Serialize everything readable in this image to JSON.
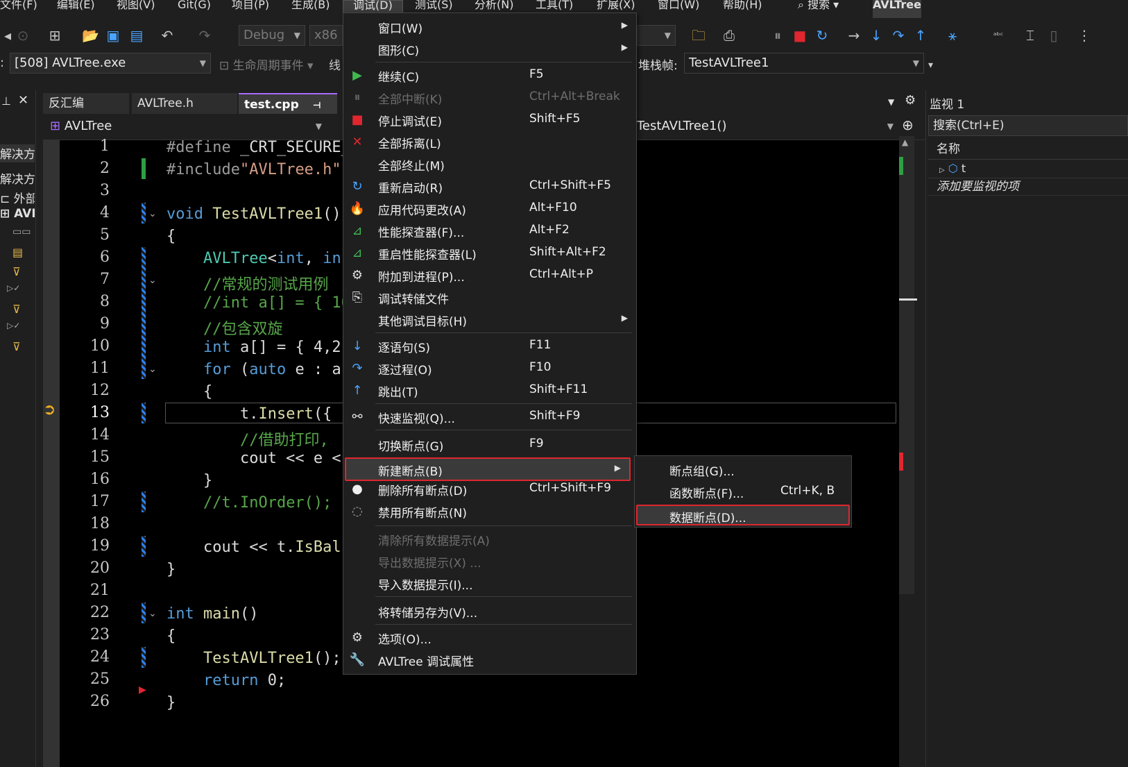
{
  "menubar": {
    "items": [
      "文件(F)",
      "编辑(E)",
      "视图(V)",
      "Git(G)",
      "项目(P)",
      "生成(B)",
      "调试(D)",
      "测试(S)",
      "分析(N)",
      "工具(T)",
      "扩展(X)",
      "窗口(W)",
      "帮助(H)"
    ],
    "search_label": "搜索",
    "app_title": "AVLTree"
  },
  "toolbar": {
    "config": "Debug",
    "platform": "x86",
    "process": "[508] AVLTree.exe",
    "lifecycle_label": "生命周期事件",
    "thread_label": "线",
    "stackframe_label": "堆栈帧:",
    "stackframe_value": "TestAVLTree1"
  },
  "left_panel": {
    "items": [
      "解决方",
      "解决方",
      "外部",
      "AVL"
    ]
  },
  "tabs": [
    {
      "label": "反汇编"
    },
    {
      "label": "AVLTree.h"
    },
    {
      "label": "test.cpp"
    }
  ],
  "nav": {
    "scope": "AVLTree",
    "function": "TestAVLTree1()"
  },
  "code": {
    "line_numbers": [
      "1",
      "2",
      "3",
      "4",
      "5",
      "6",
      "7",
      "8",
      "9",
      "10",
      "11",
      "12",
      "13",
      "14",
      "15",
      "16",
      "17",
      "18",
      "19",
      "20",
      "21",
      "22",
      "23",
      "24",
      "25",
      "26"
    ],
    "current_line": "13"
  },
  "watch": {
    "title": "监视 1",
    "search_placeholder": "搜索(Ctrl+E)",
    "column_name": "名称",
    "row_variable": "t",
    "add_item_hint": "添加要监视的项"
  },
  "debug_menu": {
    "items": [
      {
        "label": "窗口(W)",
        "shortcut": "",
        "sub": true
      },
      {
        "label": "图形(C)",
        "shortcut": "",
        "sub": true
      },
      {
        "label": "继续(C)",
        "shortcut": "F5"
      },
      {
        "label": "全部中断(K)",
        "shortcut": "Ctrl+Alt+Break",
        "disabled": true
      },
      {
        "label": "停止调试(E)",
        "shortcut": "Shift+F5"
      },
      {
        "label": "全部拆离(L)",
        "shortcut": ""
      },
      {
        "label": "全部终止(M)",
        "shortcut": ""
      },
      {
        "label": "重新启动(R)",
        "shortcut": "Ctrl+Shift+F5"
      },
      {
        "label": "应用代码更改(A)",
        "shortcut": "Alt+F10"
      },
      {
        "label": "性能探查器(F)...",
        "shortcut": "Alt+F2"
      },
      {
        "label": "重启性能探查器(L)",
        "shortcut": "Shift+Alt+F2"
      },
      {
        "label": "附加到进程(P)...",
        "shortcut": "Ctrl+Alt+P"
      },
      {
        "label": "调试转储文件",
        "shortcut": ""
      },
      {
        "label": "其他调试目标(H)",
        "shortcut": "",
        "sub": true
      },
      {
        "label": "逐语句(S)",
        "shortcut": "F11"
      },
      {
        "label": "逐过程(O)",
        "shortcut": "F10"
      },
      {
        "label": "跳出(T)",
        "shortcut": "Shift+F11"
      },
      {
        "label": "快速监视(Q)...",
        "shortcut": "Shift+F9"
      },
      {
        "label": "切换断点(G)",
        "shortcut": "F9"
      },
      {
        "label": "新建断点(B)",
        "shortcut": "",
        "sub": true
      },
      {
        "label": "删除所有断点(D)",
        "shortcut": "Ctrl+Shift+F9"
      },
      {
        "label": "禁用所有断点(N)",
        "shortcut": ""
      },
      {
        "label": "清除所有数据提示(A)",
        "shortcut": "",
        "disabled": true
      },
      {
        "label": "导出数据提示(X) ...",
        "shortcut": "",
        "disabled": true
      },
      {
        "label": "导入数据提示(I)...",
        "shortcut": ""
      },
      {
        "label": "将转储另存为(V)...",
        "shortcut": ""
      },
      {
        "label": "选项(O)...",
        "shortcut": ""
      },
      {
        "label": "AVLTree 调试属性",
        "shortcut": ""
      }
    ]
  },
  "sub_menu": {
    "items": [
      {
        "label": "断点组(G)...",
        "shortcut": ""
      },
      {
        "label": "函数断点(F)...",
        "shortcut": "Ctrl+K, B"
      },
      {
        "label": "数据断点(D)...",
        "shortcut": ""
      }
    ]
  },
  "colors": {
    "accent_purple": "#a96bff",
    "highlight_red": "#e0262e",
    "keyword_blue": "#569cd6",
    "comment_green": "#57a64a"
  }
}
